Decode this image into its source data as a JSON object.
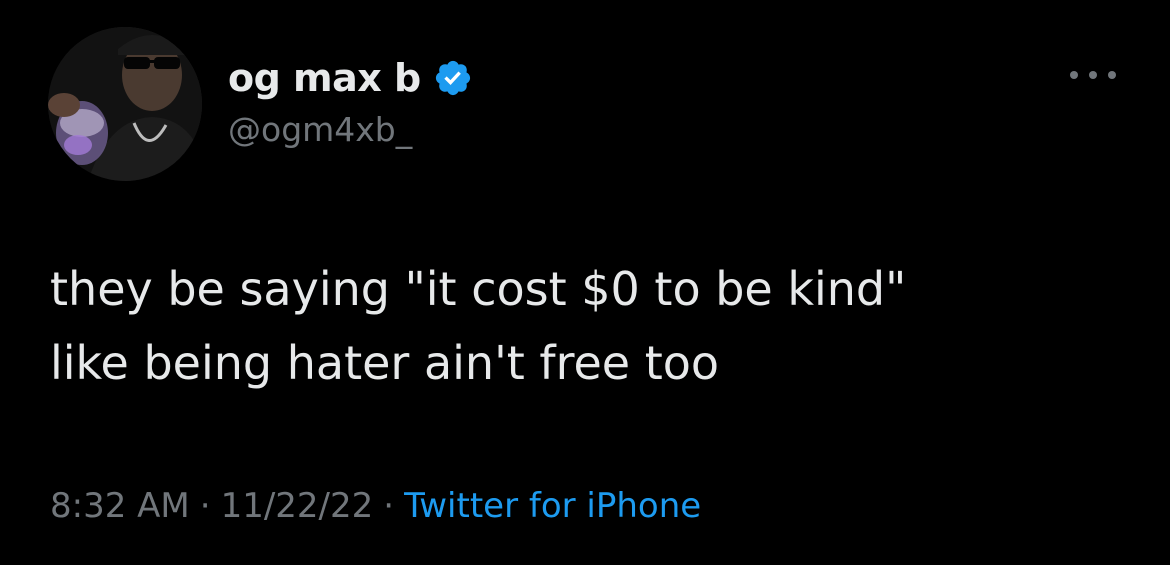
{
  "user": {
    "display_name": "og max b",
    "handle": "@ogm4xb_",
    "verified": true,
    "verified_badge_color": "#1d9bf0"
  },
  "tweet": {
    "lines": [
      "they be saying \"it cost $0 to be kind\"",
      "like being hater ain't free too"
    ]
  },
  "meta": {
    "time": "8:32 AM",
    "separator": "·",
    "date": "11/22/22",
    "source": "Twitter for iPhone"
  },
  "icons": {
    "more": "more-options-icon",
    "verified": "verified-badge-icon"
  },
  "colors": {
    "background": "#000000",
    "text": "#e7e9ea",
    "secondary": "#71767b",
    "link": "#1d9bf0"
  }
}
